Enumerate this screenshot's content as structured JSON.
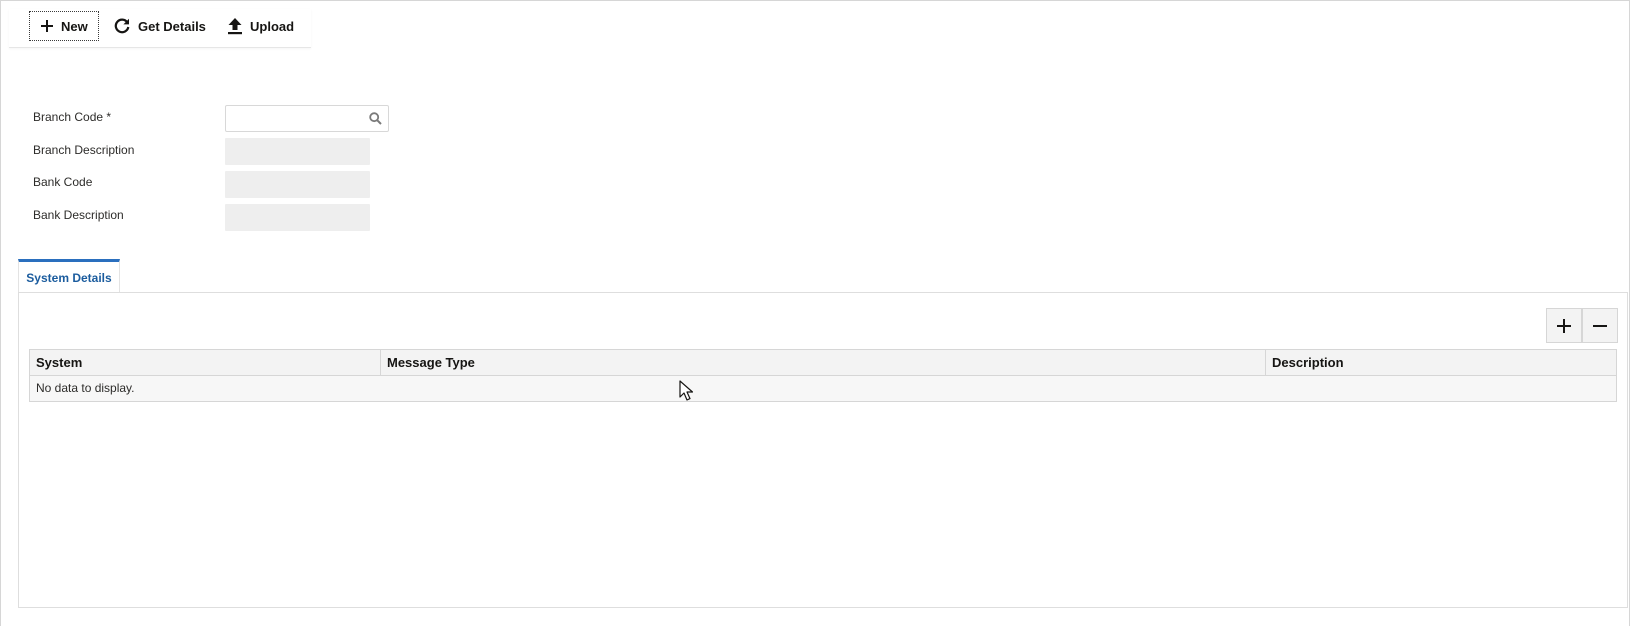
{
  "toolbar": {
    "new_label": "New",
    "new_icon": "plus-icon",
    "get_details_label": "Get Details",
    "get_details_icon": "refresh-icon",
    "upload_label": "Upload",
    "upload_icon": "upload-icon"
  },
  "form": {
    "branch_code_label": "Branch Code *",
    "branch_code_value": "",
    "branch_description_label": "Branch Description",
    "branch_description_value": "",
    "bank_code_label": "Bank Code",
    "bank_code_value": "",
    "bank_description_label": "Bank Description",
    "bank_description_value": ""
  },
  "tabs": [
    {
      "label": "System Details",
      "active": true
    }
  ],
  "grid": {
    "columns": [
      "System",
      "Message Type",
      "Description"
    ],
    "rows": [],
    "empty_text": "No data to display."
  },
  "colors": {
    "accent": "#2a6fbe",
    "tab_text": "#1b5c9e",
    "readonly_bg": "#eeeeee",
    "header_bg": "#f3f3f3"
  }
}
